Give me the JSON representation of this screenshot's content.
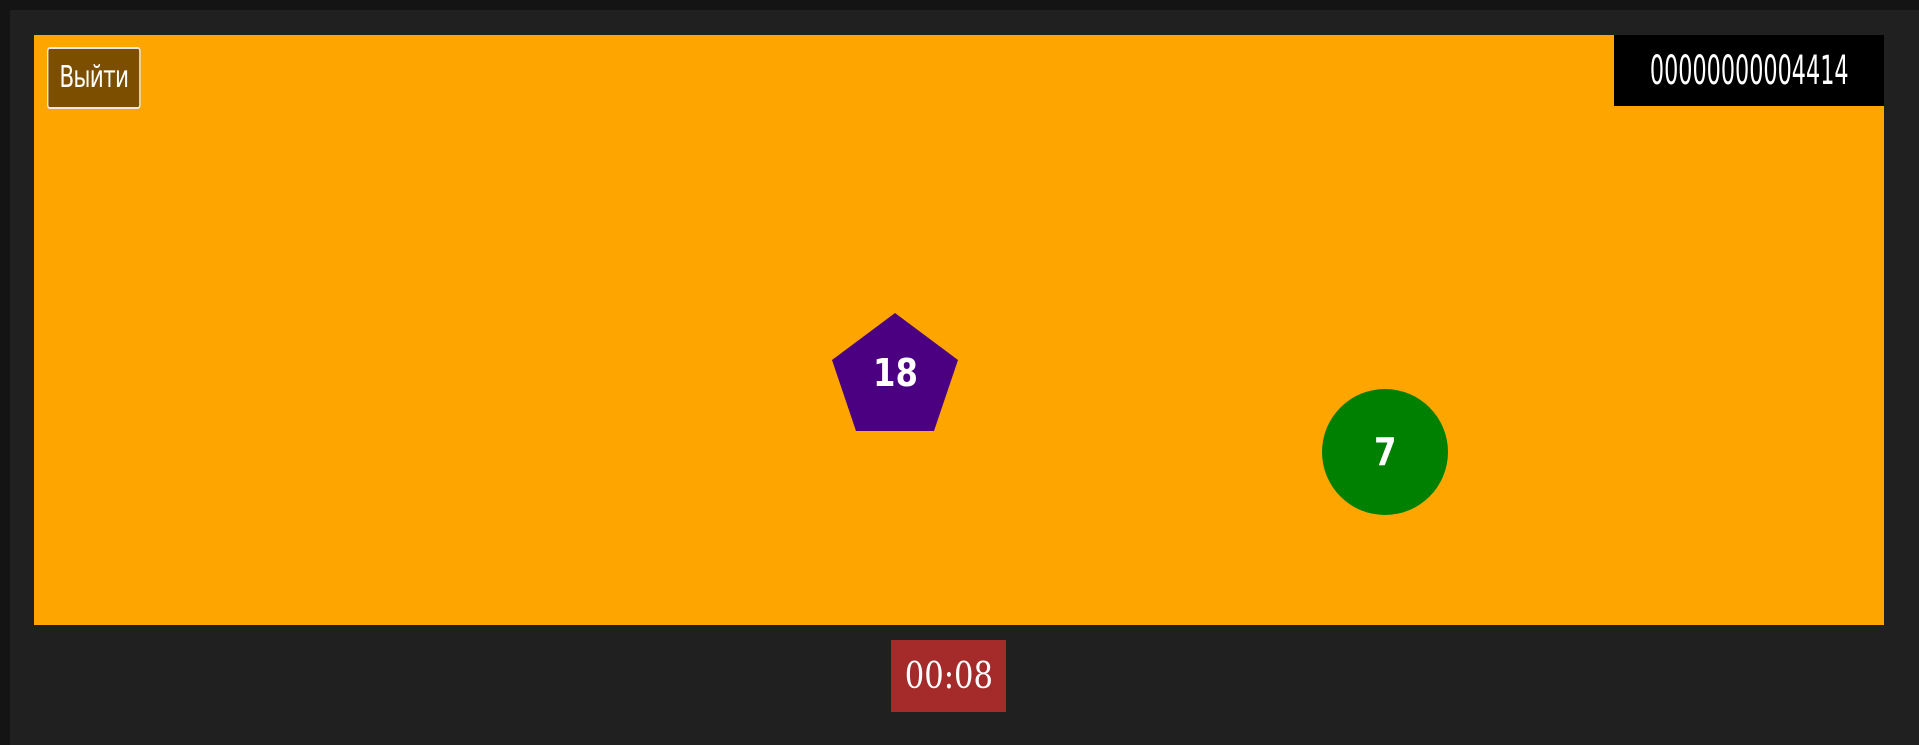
{
  "exit_button": {
    "label": "Выйти"
  },
  "score": {
    "text": "00000000004414"
  },
  "shapes": [
    {
      "kind": "pentagon",
      "number": "18",
      "color": "#4B0082"
    },
    {
      "kind": "circle",
      "number": "7",
      "color": "#008000"
    }
  ],
  "timer": {
    "text": "00:08",
    "color": "#A52A2A"
  },
  "colors": {
    "game_background": "#FFA500",
    "page_background": "#202020",
    "exit_button": "#7B4E00"
  }
}
